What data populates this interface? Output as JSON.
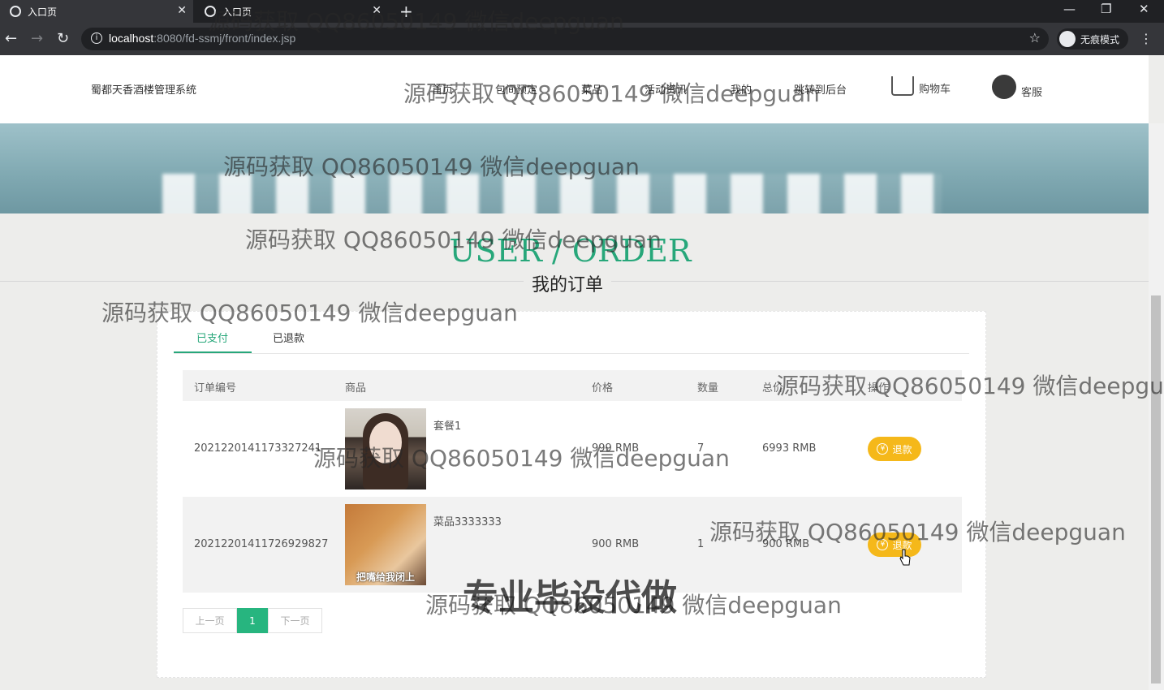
{
  "browser": {
    "tabs": [
      {
        "title": "入口页",
        "active": true
      },
      {
        "title": "入口页",
        "active": false
      }
    ],
    "new_tab": "+",
    "url_host": "localhost",
    "url_rest": ":8080/fd-ssmj/front/index.jsp",
    "incognito_label": "无痕模式"
  },
  "header": {
    "site_title": "蜀都天香酒楼管理系统",
    "nav": [
      "首页",
      "包间预定",
      "菜品",
      "活动资讯",
      "我的",
      "跳转到后台"
    ],
    "cart_label": "购物车",
    "service_label": "客服"
  },
  "section": {
    "title_en": "USER / ORDER",
    "title_cn": "我的订单"
  },
  "orders": {
    "tabs": [
      "已支付",
      "已退款"
    ],
    "active_tab": 0,
    "columns": [
      "订单编号",
      "商品",
      "价格",
      "数量",
      "总价",
      "操作"
    ],
    "rows": [
      {
        "order_no": "2021220141173327241",
        "product": "套餐1",
        "price": "999 RMB",
        "qty": "7",
        "total": "6993 RMB",
        "action": "退款"
      },
      {
        "order_no": "20212201411726929827",
        "product": "菜品3333333",
        "price": "900 RMB",
        "qty": "1",
        "total": "900 RMB",
        "action": "退款",
        "thumb_caption": "把嘴给我闭上"
      }
    ],
    "pager": {
      "prev": "上一页",
      "current": "1",
      "next": "下一页"
    }
  },
  "watermarks": {
    "text": "源码获取 QQ86050149 微信deepguan",
    "big": "专业毕设代做"
  },
  "colors": {
    "accent_green": "#27a77a",
    "refund_orange": "#f5b81a",
    "chrome_dark": "#202124"
  }
}
